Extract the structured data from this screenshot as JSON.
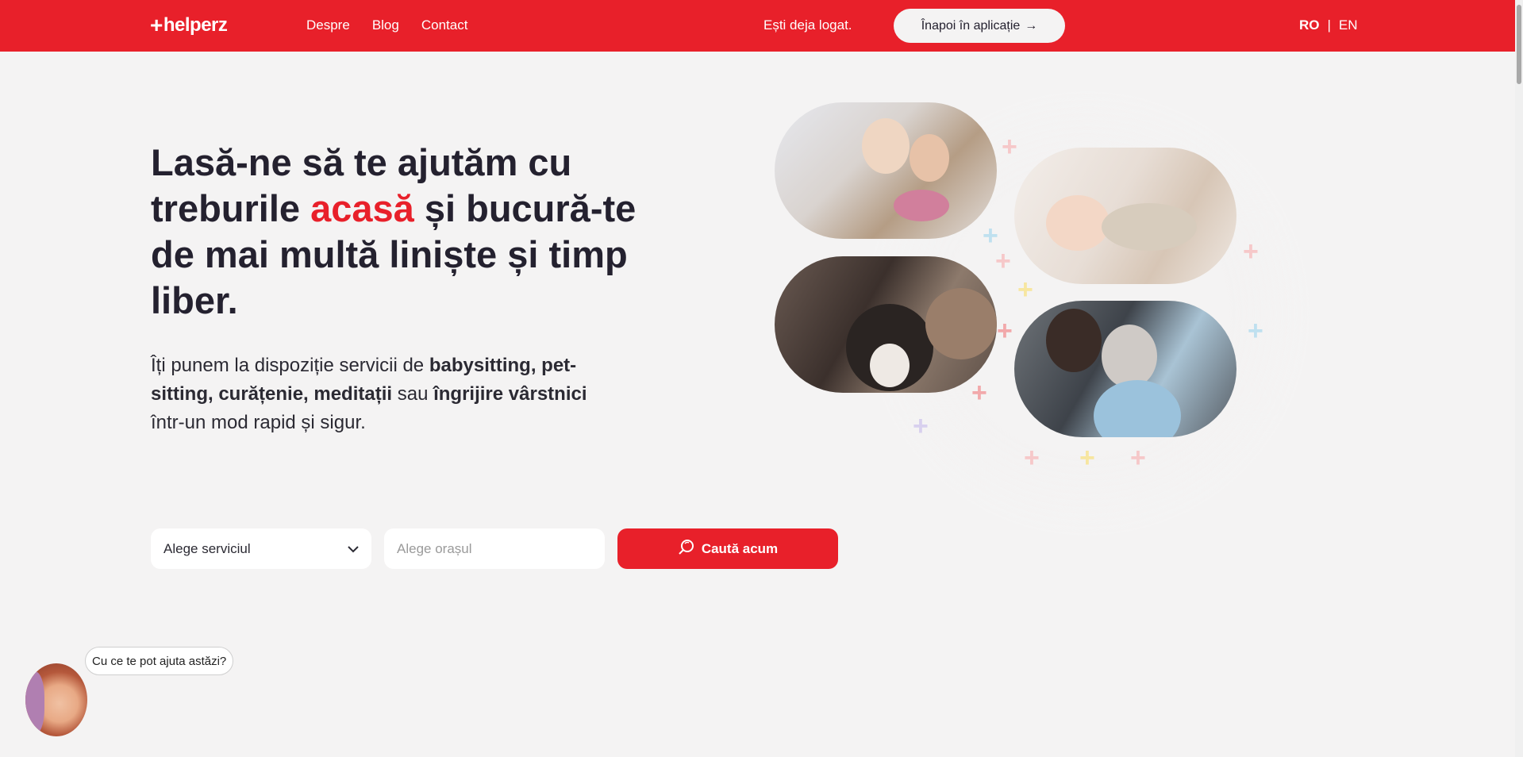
{
  "header": {
    "logo": "helperz",
    "nav": [
      "Despre",
      "Blog",
      "Contact"
    ],
    "logged_in_text": "Ești deja logat.",
    "back_button": "Înapoi în aplicație",
    "back_arrow": "→",
    "lang_active": "RO",
    "lang_sep": "|",
    "lang_other": "EN"
  },
  "hero": {
    "headline_part1": "Lasă-ne să te ajutăm cu treburile ",
    "headline_accent": "acasă",
    "headline_part2": " și bucură-te de mai multă liniște și timp liber.",
    "sub_1": "Îți punem la dispoziție servicii de ",
    "sub_b1": "babysitting, pet-sitting, curățenie, meditații",
    "sub_2": " sau ",
    "sub_b2": "îngrijire vârstnici",
    "sub_3": " într-un mod rapid și sigur."
  },
  "search": {
    "service_placeholder": "Alege serviciul",
    "city_placeholder": "Alege orașul",
    "button": "Caută acum"
  },
  "assistant": {
    "bubble": "Cu ce te pot ajuta astăzi?"
  },
  "colors": {
    "brand": "#e8202a",
    "background": "#f4f3f3",
    "text": "#24212f"
  },
  "icons": [
    "chevron-down-icon",
    "search-icon",
    "arrow-right-icon",
    "logo-plus-icon"
  ]
}
